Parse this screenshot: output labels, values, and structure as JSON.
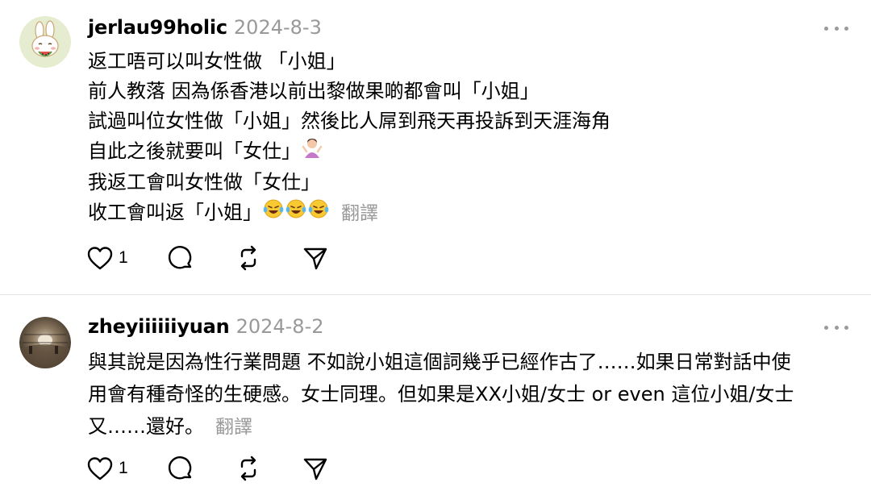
{
  "posts": [
    {
      "username": "jerlau99holic",
      "date": "2024-8-3",
      "lines": [
        "返工唔可以叫女性做 「小姐」",
        "前人教落 因為係香港以前出黎做果啲都會叫「小姐」",
        "試過叫位女性做「小姐」然後比人屌到飛天再投訴到天涯海角",
        "自此之後就要叫「女仕」",
        "我返工會叫女性做「女仕」",
        "收工會叫返「小姐」"
      ],
      "translate_label": "翻譯",
      "like_count": "1",
      "avatar_icon": "bunny-avatar-icon"
    },
    {
      "username": "zheyiiiiiiyuan",
      "date": "2024-8-2",
      "lines": [
        "與其說是因為性行業問題 不如說小姐這個詞幾乎已經作古了……如果日常對話中使",
        "用會有種奇怪的生硬感。女士同理。但如果是XX小姐/女士 or even 這位小姐/女士",
        "又……還好。"
      ],
      "translate_label": "翻譯",
      "like_count": "1",
      "avatar_icon": "photo-avatar-icon"
    }
  ],
  "colors": {
    "text": "#000000",
    "muted": "#999999",
    "divider": "#e5e5e5"
  }
}
